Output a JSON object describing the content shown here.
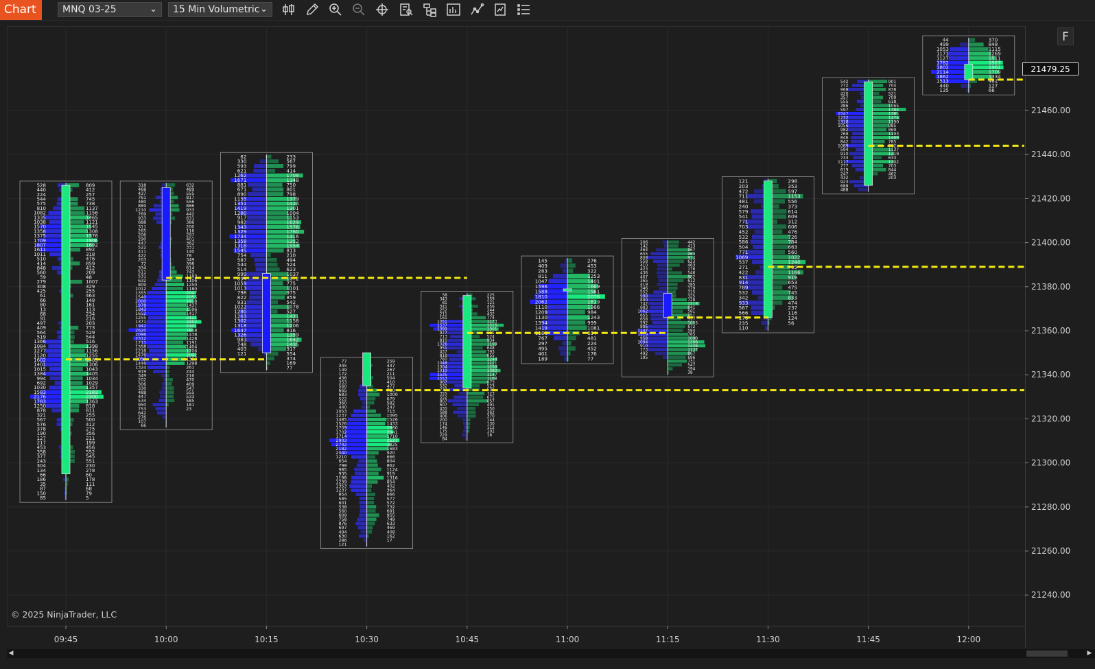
{
  "toolbar": {
    "chart_tab": "Chart",
    "instrument": "MNQ 03-25",
    "period": "15 Min Volumetric",
    "icons": [
      "bar-type-icon",
      "pencil-icon",
      "zoom-in-icon",
      "zoom-out-icon",
      "crosshair-icon",
      "data-box-icon",
      "hierarchy-icon",
      "indicators-icon",
      "strategies-icon",
      "properties-icon",
      "menu-list-icon"
    ]
  },
  "copyright": "© 2025 NinjaTrader, LLC",
  "float_button": "F",
  "last_price": "21479.25",
  "colors": {
    "bid": "#1f1fff",
    "ask": "#1ec26b",
    "poc_line": "#f4ea12",
    "up_candle": "#19e87e",
    "down_candle": "#1a1aff",
    "magenta": "#ff2aff",
    "cyan": "#2ad8ff"
  },
  "chart_data": {
    "type": "volumetric-footprint",
    "xlabels": [
      "09:45",
      "10:00",
      "10:15",
      "10:30",
      "10:45",
      "11:00",
      "11:15",
      "11:30",
      "11:45",
      "12:00"
    ],
    "ylabels": [
      "21460.00",
      "21440.00",
      "21420.00",
      "21400.00",
      "21380.00",
      "21360.00",
      "21340.00",
      "21320.00",
      "21300.00",
      "21280.00",
      "21260.00",
      "21240.00"
    ],
    "bars": [
      {
        "time": "09:45",
        "open": 21295,
        "close": 21426,
        "high": 21427,
        "low": 21283,
        "poc": 21347,
        "bid": [
          "528",
          "440",
          "224",
          "544",
          "575",
          "810",
          "1082",
          "1335",
          "1038",
          "1570",
          "1358",
          "1375",
          "1709",
          "1807",
          "1611",
          "1011",
          "510",
          "414",
          "848",
          "560",
          "59",
          "279",
          "308",
          "425",
          "61",
          "66",
          "80",
          "13",
          "68",
          "91",
          "497",
          "409",
          "564",
          "519",
          "1366",
          "1084",
          "1277",
          "1120",
          "1602",
          "1401",
          "1015",
          "1384",
          "994",
          "692",
          "1030",
          "1583",
          "2176",
          "1783",
          "1250",
          "878",
          "321",
          "567",
          "576",
          "378",
          "190",
          "127",
          "217",
          "453",
          "358",
          "377",
          "243",
          "304",
          "134",
          "66",
          "186",
          "35",
          "87",
          "150",
          "85"
        ],
        "ask": [
          "809",
          "412",
          "257",
          "745",
          "738",
          "1137",
          "1156",
          "1465",
          "1121",
          "1545",
          "1308",
          "1576",
          "1906",
          "1692",
          "892",
          "318",
          "476",
          "859",
          "412",
          "209",
          "48",
          "1007",
          "329",
          "255",
          "463",
          "148",
          "161",
          "113",
          "234",
          "216",
          "203",
          "773",
          "529",
          "544",
          "516",
          "1398",
          "1156",
          "1255",
          "1483",
          "1306",
          "1043",
          "1405",
          "1034",
          "1029",
          "1357",
          "2183",
          "2300",
          "1363",
          "818",
          "811",
          "255",
          "500",
          "412",
          "275",
          "356",
          "211",
          "199",
          "456",
          "552",
          "545",
          "551",
          "230",
          "278",
          "60",
          "178",
          "111",
          "68",
          "79",
          "5"
        ]
      },
      {
        "time": "10:00",
        "open": 21425,
        "close": 21383,
        "high": 21427,
        "low": 21316,
        "poc": 21346,
        "bid": [
          "318",
          "468",
          "437",
          "761",
          "480",
          "889",
          "1210",
          "769",
          "933",
          "688",
          "311",
          "265",
          "206",
          "290",
          "447",
          "522",
          "411",
          "422",
          "203",
          "72",
          "334",
          "511",
          "531",
          "632",
          "809",
          "1012",
          "1355",
          "1540",
          "2000",
          "1978",
          "1843",
          "1652",
          "1255",
          "1371",
          "1942",
          "2620",
          "2096",
          "2312",
          "1711",
          "1358",
          "1218",
          "1476",
          "2053",
          "1446",
          "1324",
          "919",
          "349",
          "202",
          "306",
          "330",
          "488",
          "447",
          "534",
          "950",
          "753",
          "642",
          "276",
          "107",
          "66"
        ],
        "ask": [
          "632",
          "489",
          "555",
          "817",
          "556",
          "886",
          "933",
          "442",
          "631",
          "386",
          "200",
          "116",
          "297",
          "401",
          "362",
          "331",
          "140",
          "78",
          "349",
          "398",
          "614",
          "743",
          "1183",
          "1106",
          "1250",
          "1180",
          "2047",
          "2055",
          "1918",
          "1437",
          "1596",
          "1417",
          "2121",
          "2452",
          "2101",
          "1848",
          "1438",
          "1428",
          "1191",
          "1404",
          "1706",
          "2092",
          "1383",
          "1298",
          "261",
          "244",
          "216",
          "470",
          "409",
          "547",
          "555",
          "533",
          "585",
          "181",
          "23"
        ]
      },
      {
        "time": "10:15",
        "open": 21386,
        "close": 21350,
        "high": 21440,
        "low": 21342,
        "poc": 21347,
        "bid": [
          "82",
          "330",
          "593",
          "621",
          "1262",
          "1671",
          "881",
          "671",
          "890",
          "1155",
          "1351",
          "1419",
          "1280",
          "917",
          "982",
          "1343",
          "1329",
          "1734",
          "1358",
          "1318",
          "1545",
          "754",
          "587",
          "544",
          "514",
          "999",
          "894",
          "1059",
          "1013",
          "798",
          "822",
          "931",
          "1022",
          "1280",
          "1263",
          "1302",
          "1318",
          "1647",
          "1326",
          "983",
          "748",
          "403",
          "121"
        ],
        "ask": [
          "233",
          "567",
          "799",
          "414",
          "1708",
          "1348",
          "750",
          "801",
          "798",
          "1379",
          "1424",
          "1301",
          "1004",
          "1153",
          "1629",
          "1576",
          "1760",
          "1316",
          "1352",
          "1554",
          "813",
          "210",
          "494",
          "524",
          "623",
          "1037",
          "1072",
          "775",
          "1101",
          "975",
          "859",
          "542",
          "1078",
          "527",
          "1421",
          "1158",
          "1206",
          "816",
          "1359",
          "1642",
          "1435",
          "917",
          "554",
          "374",
          "169",
          "77"
        ]
      },
      {
        "time": "10:30",
        "open": 21335,
        "close": 21350,
        "high": 21347,
        "low": 21262,
        "poc": 21334,
        "bid": [
          "77",
          "345",
          "149",
          "172",
          "436",
          "353",
          "560",
          "665",
          "683",
          "522",
          "360",
          "440",
          "1053",
          "1237",
          "1485",
          "1526",
          "1709",
          "1702",
          "1714",
          "2903",
          "2742",
          "2182",
          "2040",
          "1210",
          "654",
          "798",
          "985",
          "935",
          "1198",
          "1239",
          "1353",
          "1237",
          "854",
          "585",
          "601",
          "538",
          "560",
          "609",
          "758",
          "876",
          "697",
          "494",
          "630",
          "286",
          "121"
        ],
        "ask": [
          "259",
          "437",
          "267",
          "211",
          "504",
          "410",
          "477",
          "780",
          "1000",
          "679",
          "582",
          "247",
          "713",
          "1095",
          "1526",
          "1433",
          "1960",
          "2041",
          "1710",
          "2527",
          "1825",
          "1683",
          "920",
          "666",
          "804",
          "862",
          "1124",
          "919",
          "1316",
          "854",
          "402",
          "364",
          "666",
          "577",
          "572",
          "732",
          "691",
          "955",
          "749",
          "633",
          "469",
          "408",
          "162",
          "17"
        ]
      },
      {
        "time": "10:45",
        "open": 21334,
        "close": 21376,
        "high": 21377,
        "low": 21310,
        "poc": 21360,
        "bid": [
          "58",
          "343",
          "81",
          "341",
          "252",
          "211",
          "161",
          "1051",
          "1537",
          "1399",
          "927",
          "713",
          "810",
          "1026",
          "951",
          "437",
          "818",
          "760",
          "1048",
          "1004",
          "1010",
          "1535",
          "1553",
          "967",
          "532",
          "772",
          "355",
          "552",
          "807",
          "607",
          "430",
          "588",
          "406",
          "200",
          "174",
          "146",
          "175",
          "229",
          "84"
        ],
        "ask": [
          "225",
          "359",
          "121",
          "456",
          "244",
          "432",
          "774",
          "1133",
          "1515",
          "1301",
          "651",
          "524",
          "934",
          "1199",
          "648",
          "793",
          "855",
          "1244",
          "1121",
          "1250",
          "1380",
          "1147",
          "1168",
          "873",
          "523",
          "537",
          "723",
          "671",
          "857",
          "491",
          "350",
          "362",
          "370",
          "144",
          "130",
          "112",
          "102",
          "16"
        ]
      },
      {
        "time": "11:00",
        "open": 21378,
        "close": 21379,
        "high": 21393,
        "low": 21346,
        "poc": 21360,
        "bid": [
          "145",
          "409",
          "283",
          "811",
          "1047",
          "1596",
          "1588",
          "1810",
          "2062",
          "1110",
          "1209",
          "1130",
          "1394",
          "1419",
          "1160",
          "767",
          "297",
          "495",
          "401",
          "189"
        ],
        "ask": [
          "276",
          "453",
          "322",
          "1253",
          "1401",
          "1669",
          "1561",
          "2076",
          "1619",
          "1366",
          "984",
          "1243",
          "999",
          "1081",
          "694",
          "481",
          "224",
          "452",
          "176",
          "77"
        ]
      },
      {
        "time": "11:15",
        "open": 21377,
        "close": 21366,
        "high": 21401,
        "low": 21340,
        "poc": 21366,
        "bid": [
          "206",
          "142",
          "464",
          "655",
          "808",
          "558",
          "410",
          "423",
          "436",
          "407",
          "365",
          "419",
          "346",
          "552",
          "998",
          "880",
          "742",
          "683",
          "1062",
          "655",
          "658",
          "592",
          "885",
          "1147",
          "1119",
          "958",
          "1094",
          "910",
          "773",
          "492",
          "195"
        ],
        "ask": [
          "442",
          "413",
          "867",
          "969",
          "974",
          "623",
          "463",
          "176",
          "546",
          "882",
          "612",
          "385",
          "379",
          "315",
          "325",
          "728",
          "1218",
          "841",
          "581",
          "851",
          "517",
          "1005",
          "672",
          "584",
          "785",
          "1090",
          "1396",
          "1436",
          "1137",
          "867",
          "696",
          "731",
          "547",
          "194",
          "39"
        ]
      },
      {
        "time": "11:30",
        "open": 21366,
        "close": 21428,
        "high": 21429,
        "low": 21360,
        "poc": 21389,
        "bid": [
          "121",
          "203",
          "472",
          "711",
          "481",
          "240",
          "579",
          "541",
          "771",
          "703",
          "452",
          "532",
          "586",
          "504",
          "771",
          "1069",
          "537",
          "271",
          "422",
          "831",
          "914",
          "789",
          "532",
          "342",
          "933",
          "567",
          "566",
          "170",
          "235",
          "110"
        ],
        "ask": [
          "298",
          "353",
          "597",
          "1153",
          "556",
          "373",
          "614",
          "609",
          "312",
          "606",
          "476",
          "726",
          "784",
          "663",
          "560",
          "1022",
          "1240",
          "705",
          "1166",
          "919",
          "653",
          "475",
          "745",
          "833",
          "474",
          "237",
          "116",
          "124",
          "56"
        ]
      },
      {
        "time": "11:45",
        "open": 21426,
        "close": 21473,
        "high": 21474,
        "low": 21423,
        "poc": 21444,
        "bid": [
          "542",
          "772",
          "968",
          "420",
          "357",
          "555",
          "386",
          "597",
          "1547",
          "1232",
          "1318",
          "1056",
          "982",
          "769",
          "846",
          "842",
          "1089",
          "594",
          "910",
          "733",
          "1117",
          "777",
          "619",
          "247",
          "432",
          "923",
          "688",
          "488"
        ],
        "ask": [
          "901",
          "704",
          "838",
          "521",
          "709",
          "618",
          "1065",
          "1784",
          "1385",
          "1474",
          "1190",
          "985",
          "869",
          "1193",
          "1469",
          "785",
          "702",
          "1137",
          "1219",
          "633",
          "1202",
          "703",
          "844",
          "462",
          "203"
        ]
      },
      {
        "time": "12:00",
        "open": 21474,
        "close": 21481,
        "high": 21493,
        "low": 21468,
        "poc": 21474,
        "bid": [
          "44",
          "499",
          "1053",
          "1171",
          "1127",
          "1782",
          "1802",
          "2114",
          "1862",
          "1513",
          "440",
          "135"
        ],
        "ask": [
          "370",
          "848",
          "1115",
          "1269",
          "1511",
          "1927",
          "1961",
          "1709",
          "1334",
          "481",
          "127",
          "66"
        ]
      }
    ],
    "poc_lines": [
      {
        "from": "09:45",
        "to": "10:15",
        "price": 21347
      },
      {
        "from": "10:00",
        "to": "10:45",
        "price": 21384
      },
      {
        "from": "10:30",
        "to": "right",
        "price": 21333
      },
      {
        "from": "10:45",
        "to": "11:15",
        "price": 21359
      },
      {
        "from": "11:15",
        "to": "11:30",
        "price": 21366
      },
      {
        "from": "11:30",
        "to": "right",
        "price": 21389
      },
      {
        "from": "11:45",
        "to": "right",
        "price": 21444
      },
      {
        "from": "12:00",
        "to": "right",
        "price": 21474
      }
    ]
  }
}
